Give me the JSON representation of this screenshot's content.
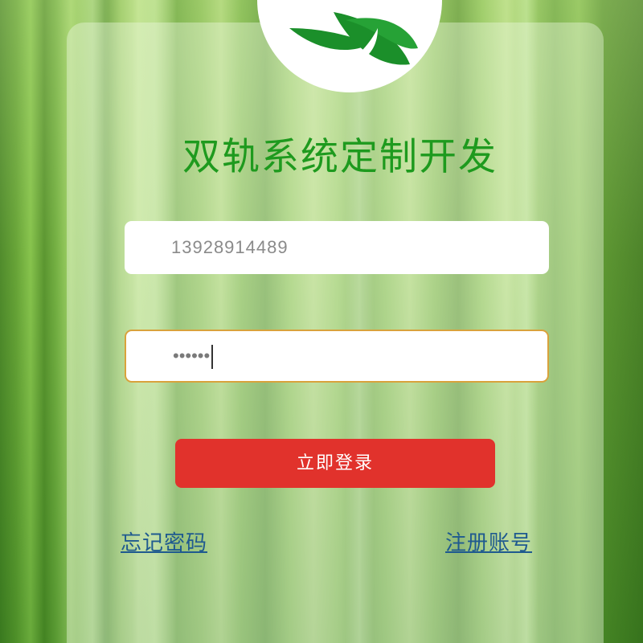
{
  "app": {
    "title": "双轨系统定制开发"
  },
  "logo": {
    "icon": "leaf-logo-icon",
    "colors": [
      "#1b8f2a",
      "#ffffff"
    ]
  },
  "form": {
    "phone_value": "13928914489",
    "password_value": "••••••",
    "login_label": "立即登录",
    "forgot_label": "忘记密码",
    "register_label": "注册账号"
  },
  "colors": {
    "title": "#1e9a1e",
    "login_button": "#e1322c",
    "link": "#1f5a8f",
    "password_border": "#d9a23c"
  }
}
